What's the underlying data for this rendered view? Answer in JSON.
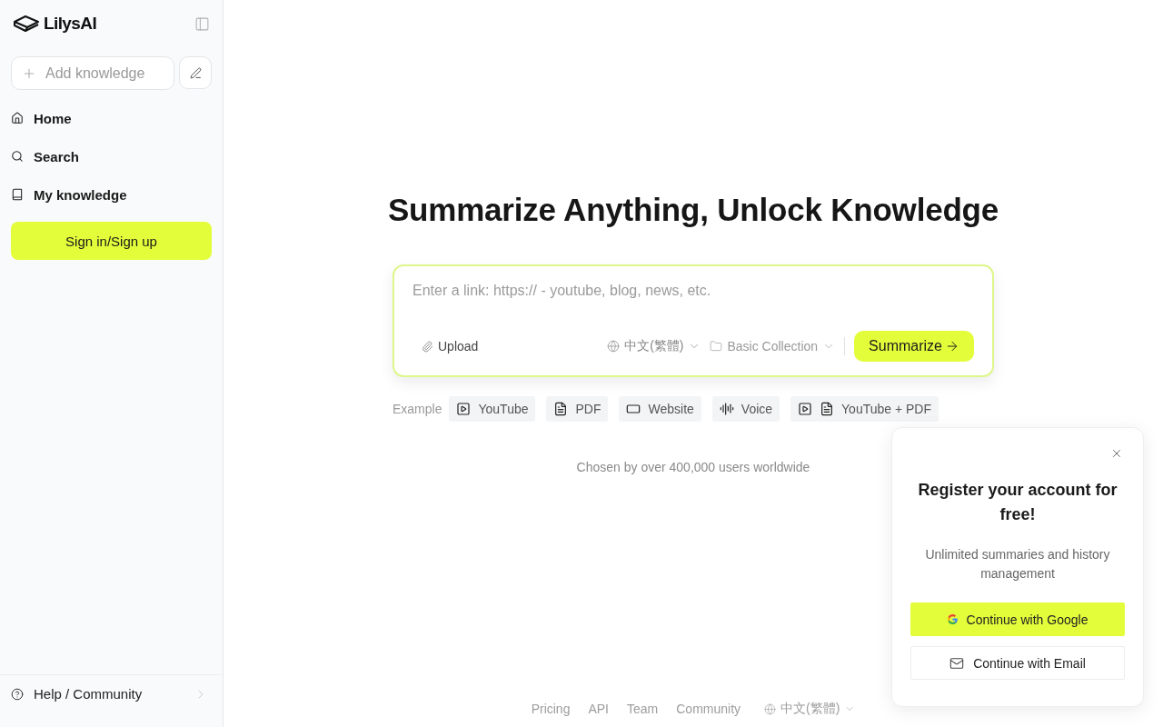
{
  "sidebar": {
    "logo": "LilysAI",
    "add_knowledge": "Add knowledge",
    "nav": [
      {
        "label": "Home",
        "kind": "home"
      },
      {
        "label": "Search",
        "kind": "search"
      },
      {
        "label": "My knowledge",
        "kind": "book"
      }
    ],
    "sign_in": "Sign in/Sign up",
    "help": "Help / Community"
  },
  "main": {
    "heading": "Summarize Anything, Unlock Knowledge",
    "input": {
      "placeholder": "Enter a link: https:// - youtube, blog, news, etc."
    },
    "upload": "Upload",
    "language": "中文(繁體)",
    "collection": "Basic Collection",
    "submit": "Summarize",
    "example_label": "Example",
    "examples": [
      {
        "label": "YouTube",
        "kind": "video"
      },
      {
        "label": "PDF",
        "kind": "document"
      },
      {
        "label": "Website",
        "kind": "website"
      },
      {
        "label": "Voice",
        "kind": "voice"
      },
      {
        "label": "YouTube + PDF",
        "kind": "combined"
      }
    ],
    "tagline": "Chosen by over 400,000 users worldwide"
  },
  "footer": {
    "links": [
      "Pricing",
      "API",
      "Team",
      "Community"
    ],
    "language": "中文(繁體)"
  },
  "popup": {
    "title": "Register your account for free!",
    "description": "Unlimited summaries and history management",
    "buttons": [
      {
        "label": "Continue with Google",
        "kind": "google"
      },
      {
        "label": "Continue with Email",
        "kind": "email"
      }
    ]
  }
}
